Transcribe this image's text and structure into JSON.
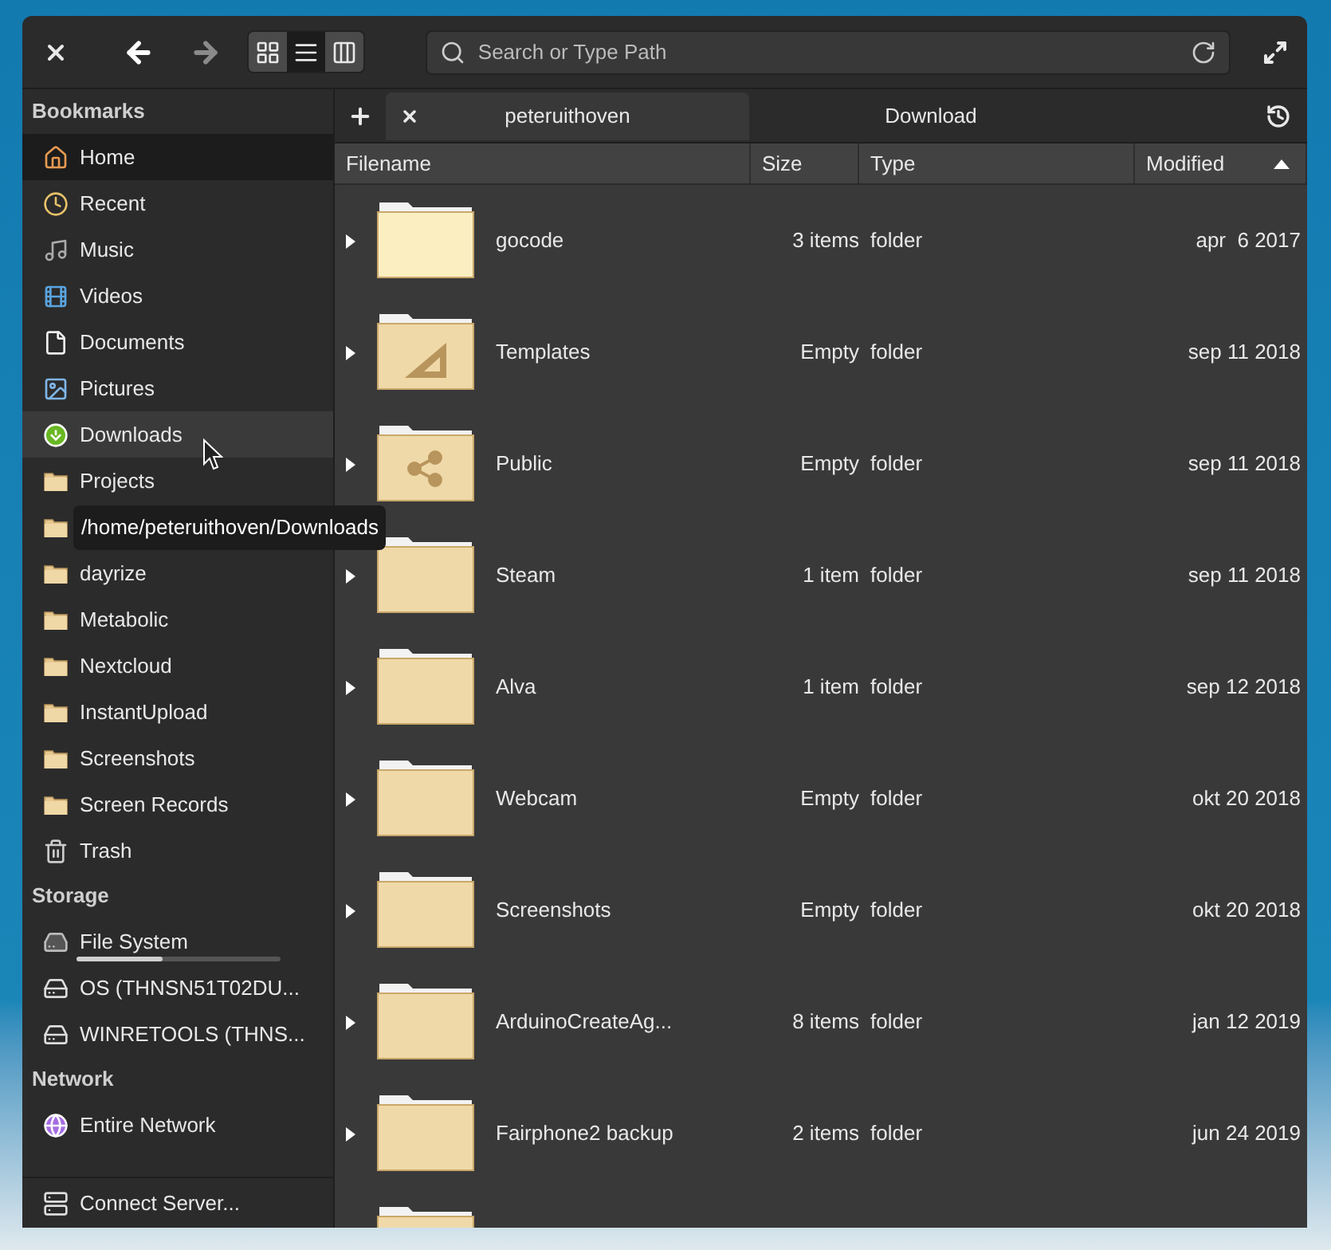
{
  "toolbar": {
    "back_disabled": false,
    "forward_disabled": true,
    "view_modes": [
      {
        "kind": "grid",
        "selected": false
      },
      {
        "kind": "list",
        "selected": true
      },
      {
        "kind": "columns",
        "selected": false
      }
    ],
    "search": {
      "placeholder": "Search or Type Path"
    }
  },
  "sidebar": {
    "sections": [
      {
        "title": "Bookmarks",
        "items": [
          {
            "kind": "home",
            "label": "Home",
            "selected": true,
            "hovered": false
          },
          {
            "kind": "recent",
            "label": "Recent",
            "selected": false,
            "hovered": false
          },
          {
            "kind": "music",
            "label": "Music",
            "selected": false,
            "hovered": false
          },
          {
            "kind": "videos",
            "label": "Videos",
            "selected": false,
            "hovered": false
          },
          {
            "kind": "documents",
            "label": "Documents",
            "selected": false,
            "hovered": false
          },
          {
            "kind": "pictures",
            "label": "Pictures",
            "selected": false,
            "hovered": false
          },
          {
            "kind": "downloads",
            "label": "Downloads",
            "selected": false,
            "hovered": true
          },
          {
            "kind": "folder",
            "label": "Projects",
            "selected": false,
            "hovered": false
          },
          {
            "kind": "folder",
            "selected": false,
            "hovered": false
          },
          {
            "kind": "folder",
            "label": "dayrize",
            "selected": false,
            "hovered": false
          },
          {
            "kind": "folder",
            "label": "Metabolic",
            "selected": false,
            "hovered": false
          },
          {
            "kind": "folder",
            "label": "Nextcloud",
            "selected": false,
            "hovered": false
          },
          {
            "kind": "folder",
            "label": "InstantUpload",
            "selected": false,
            "hovered": false
          },
          {
            "kind": "folder",
            "label": "Screenshots",
            "selected": false,
            "hovered": false
          },
          {
            "kind": "folder",
            "label": "Screen Records",
            "selected": false,
            "hovered": false
          },
          {
            "kind": "trash",
            "label": "Trash",
            "selected": false,
            "hovered": false
          }
        ]
      },
      {
        "title": "Storage",
        "items": [
          {
            "kind": "system-drive",
            "label": "File System",
            "selected": false,
            "hovered": false,
            "level": 0.42
          },
          {
            "kind": "drive",
            "label": "OS (THNSN51T02DU...",
            "selected": false,
            "hovered": false
          },
          {
            "kind": "drive",
            "label": "WINRETOOLS (THNS...",
            "selected": false,
            "hovered": false
          }
        ]
      },
      {
        "title": "Network",
        "items": [
          {
            "kind": "network",
            "label": "Entire Network",
            "selected": false,
            "hovered": false
          }
        ]
      }
    ],
    "footer": {
      "label": "Connect Server..."
    },
    "tooltip": "/home/peteruithoven/Downloads"
  },
  "tabs": [
    {
      "label": "peteruithoven",
      "selected": true
    },
    {
      "label": "Download",
      "selected": false
    }
  ],
  "table": {
    "columns": [
      {
        "label": "Filename"
      },
      {
        "label": "Size"
      },
      {
        "label": "Type"
      },
      {
        "label": "Modified",
        "sort_ascending": true
      }
    ],
    "rows": [
      {
        "kind": "folder-light",
        "name": "gocode",
        "size": "3 items",
        "type": "folder",
        "modified": "apr  6 2017"
      },
      {
        "kind": "templates",
        "name": "Templates",
        "size": "Empty",
        "type": "folder",
        "modified": "sep 11 2018"
      },
      {
        "kind": "public",
        "name": "Public",
        "size": "Empty",
        "type": "folder",
        "modified": "sep 11 2018"
      },
      {
        "kind": "folder",
        "name": "Steam",
        "size": "1 item",
        "type": "folder",
        "modified": "sep 11 2018"
      },
      {
        "kind": "folder",
        "name": "Alva",
        "size": "1 item",
        "type": "folder",
        "modified": "sep 12 2018"
      },
      {
        "kind": "folder",
        "name": "Webcam",
        "size": "Empty",
        "type": "folder",
        "modified": "okt 20 2018"
      },
      {
        "kind": "folder",
        "name": "Screenshots",
        "size": "Empty",
        "type": "folder",
        "modified": "okt 20 2018"
      },
      {
        "kind": "folder",
        "name": "ArduinoCreateAg...",
        "size": "8 items",
        "type": "folder",
        "modified": "jan 12 2019"
      },
      {
        "kind": "folder",
        "name": "Fairphone2 backup",
        "size": "2 items",
        "type": "folder",
        "modified": "jun 24 2019"
      },
      {
        "kind": "folder"
      }
    ]
  }
}
